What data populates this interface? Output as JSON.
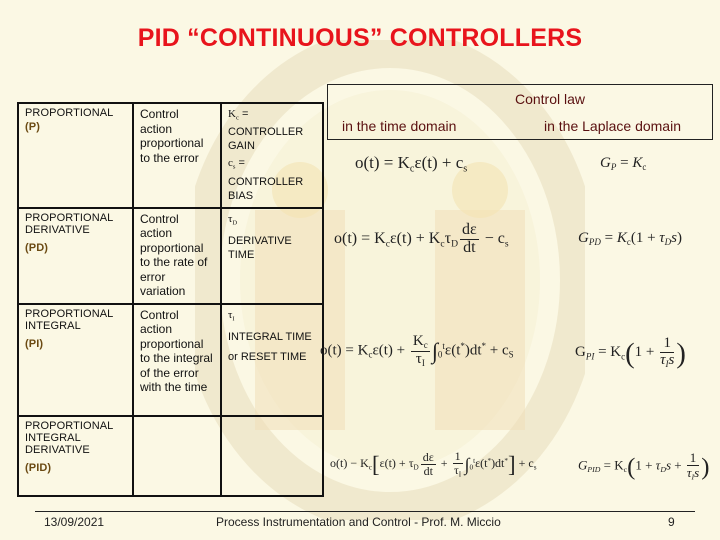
{
  "slide": {
    "title": "PID “CONTINUOUS” CONTROLLERS"
  },
  "table": {
    "rows": [
      {
        "name": "PROPORTIONAL",
        "abbr": "(P)",
        "description": "Control action proportional to the error",
        "params": [
          {
            "symbol": "K",
            "subscript": "c",
            "text": "= CONTROLLER GAIN"
          },
          {
            "symbol": "c",
            "subscript": "s",
            "text": "= CONTROLLER BIAS"
          }
        ]
      },
      {
        "name": "PROPORTIONAL DERIVATIVE",
        "abbr": "(PD)",
        "description": "Control action proportional to the rate of error variation",
        "params": [
          {
            "symbol": "τ",
            "subscript": "D",
            "text": "DERIVATIVE TIME"
          }
        ]
      },
      {
        "name": "PROPORTIONAL INTEGRAL",
        "abbr": "(PI)",
        "description": "Control action proportional to the integral of the error with the time",
        "params": [
          {
            "symbol": "τ",
            "subscript": "I",
            "text": "INTEGRAL TIME"
          },
          {
            "symbol": "",
            "subscript": "",
            "text": "or RESET TIME"
          }
        ]
      },
      {
        "name": "PROPORTIONAL INTEGRAL DERIVATIVE",
        "abbr": "(PID)",
        "description": "",
        "params": []
      }
    ]
  },
  "control_law": {
    "header": "Control law",
    "time_domain_label": "in the time domain",
    "laplace_domain_label": "in the Laplace domain",
    "equations": {
      "p_time": "o(t) = K_c ε(t) + c_s",
      "p_laplace": "G_P = K_c",
      "pd_time": "o(t) = K_c ε(t) + K_c τ_D dε/dt + c_s",
      "pd_laplace": "G_PD = K_c (1 + τ_D s)",
      "pi_time": "o(t) = K_c ε(t) + K_c/τ_I ∫_0^t ε(t*) dt* + c_s",
      "pi_laplace": "G_PI = K_c (1 + 1/(τ_I s))",
      "pid_time": "o(t) = K_c [ε(t) + τ_D dε/dt + 1/τ_I ∫_0^t ε(t*) dt*] + c_s",
      "pid_laplace": "G_PID = K_c (1 + τ_D s + 1/(τ_I s))"
    }
  },
  "footer": {
    "date": "13/09/2021",
    "course": "Process Instrumentation and Control - Prof. M. Miccio",
    "page": "9"
  },
  "colors": {
    "title": "#e8141c",
    "abbr": "#6b4a12",
    "background": "#fbf8e4",
    "control_law_text": "#5a1010"
  }
}
